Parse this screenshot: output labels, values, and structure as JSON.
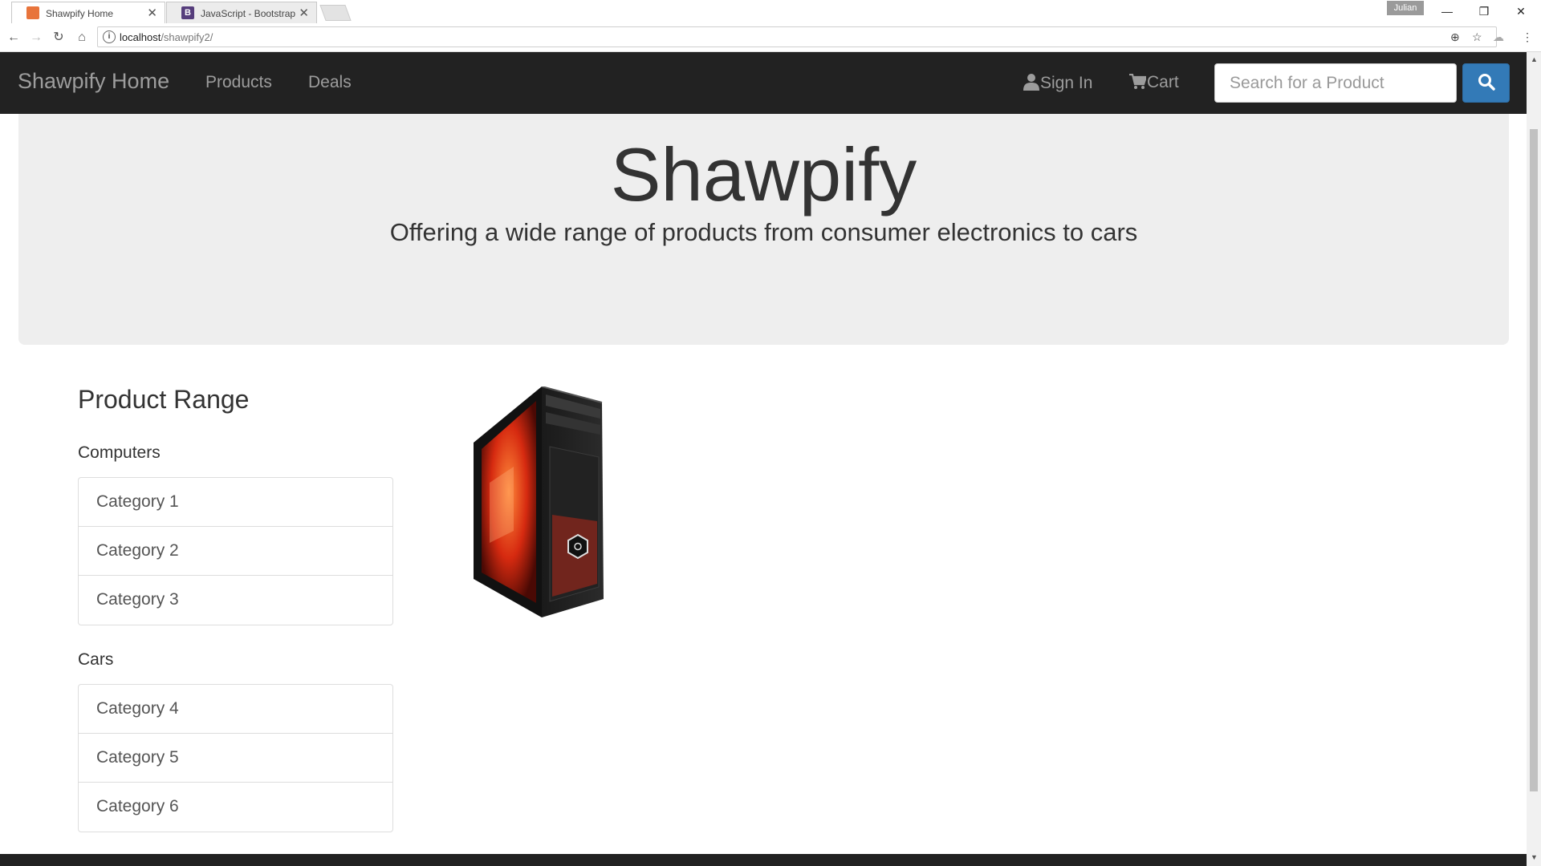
{
  "browser": {
    "tabs": [
      {
        "title": "Shawpify Home",
        "active": true,
        "favicon_color": "#e8743b"
      },
      {
        "title": "JavaScript - Bootstrap",
        "active": false,
        "favicon_color": "#563d7c"
      }
    ],
    "user": "Julian",
    "url_host": "localhost",
    "url_path": "/shawpify2/"
  },
  "navbar": {
    "brand": "Shawpify Home",
    "links": [
      "Products",
      "Deals"
    ],
    "sign_in": "Sign In",
    "cart": "Cart",
    "search_placeholder": "Search for a Product"
  },
  "jumbotron": {
    "title": "Shawpify",
    "subtitle": "Offering a wide range of products from consumer electronics to cars"
  },
  "product_range": {
    "title": "Product Range",
    "groups": [
      {
        "label": "Computers",
        "items": [
          "Category 1",
          "Category 2",
          "Category 3"
        ]
      },
      {
        "label": "Cars",
        "items": [
          "Category 4",
          "Category 5",
          "Category 6"
        ]
      }
    ]
  },
  "colors": {
    "navbar_bg": "#222222",
    "nav_text": "#9d9d9d",
    "primary": "#337ab7",
    "jumbotron_bg": "#eeeeee"
  }
}
